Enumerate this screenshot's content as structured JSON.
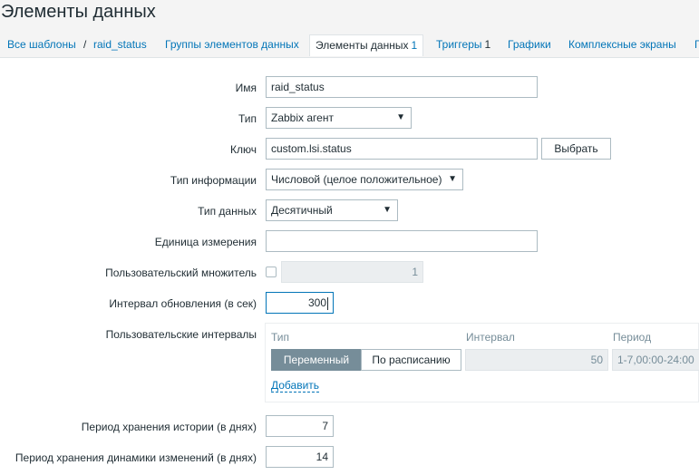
{
  "page": {
    "title": "Элементы данных"
  },
  "nav": {
    "all_templates": "Все шаблоны",
    "separator": "/",
    "template_name": "raid_status",
    "tabs": [
      {
        "label": "Группы элементов данных",
        "count": ""
      },
      {
        "label": "Элементы данных",
        "count": "1"
      },
      {
        "label": "Триггеры",
        "count": "1"
      },
      {
        "label": "Графики",
        "count": ""
      },
      {
        "label": "Комплексные экраны",
        "count": ""
      },
      {
        "label": "Г",
        "count": ""
      }
    ]
  },
  "form": {
    "name": {
      "label": "Имя",
      "value": "raid_status"
    },
    "type": {
      "label": "Тип",
      "value": "Zabbix агент"
    },
    "key": {
      "label": "Ключ",
      "value": "custom.lsi.status",
      "select_button": "Выбрать"
    },
    "info_type": {
      "label": "Тип информации",
      "value": "Числовой (целое положительное)"
    },
    "data_type": {
      "label": "Тип данных",
      "value": "Десятичный"
    },
    "units": {
      "label": "Единица измерения",
      "value": ""
    },
    "multiplier": {
      "label": "Пользовательский множитель",
      "value": "1",
      "checked": false
    },
    "update_interval": {
      "label": "Интервал обновления (в сек)",
      "value": "300"
    },
    "custom_intervals": {
      "label": "Пользовательские интервалы",
      "col_type": "Тип",
      "col_interval": "Интервал",
      "col_period": "Период",
      "opt_flexible": "Переменный",
      "opt_scheduling": "По расписанию",
      "interval_value": "50",
      "period_value": "1-7,00:00-24:00",
      "add_link": "Добавить"
    },
    "history": {
      "label": "Период хранения истории (в днях)",
      "value": "7"
    },
    "trends": {
      "label": "Период хранения динамики изменений (в днях)",
      "value": "14"
    }
  },
  "colors": {
    "accent": "#0275b8",
    "text": "#1f2c33",
    "muted": "#768d99",
    "border": "#acbbc2"
  },
  "icons": {
    "select_arrow": "▼"
  }
}
